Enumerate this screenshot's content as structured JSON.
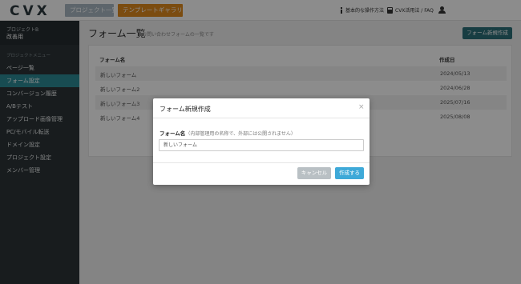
{
  "header": {
    "logo": "CVX",
    "projects_btn": "プロジェクト一覧",
    "templates_btn": "テンプレートギャラリー",
    "ops_link": "基本的な操作方法",
    "faq_link": "CVX活用法 / FAQ",
    "icons": [
      "info-icon",
      "book-icon",
      "user-icon"
    ]
  },
  "sidebar": {
    "project_name": "プロジェクトB",
    "project_sub": "改善用",
    "menu_heading": "プロジェクトメニュー",
    "items": [
      {
        "label": "ページ一覧",
        "active": false
      },
      {
        "label": "フォーム設定",
        "active": true
      },
      {
        "label": "コンバージョン履歴",
        "active": false
      },
      {
        "label": "A/Bテスト",
        "active": false
      },
      {
        "label": "アップロード画像管理",
        "active": false
      },
      {
        "label": "PC/モバイル転送",
        "active": false
      },
      {
        "label": "ドメイン設定",
        "active": false
      },
      {
        "label": "プロジェクト設定",
        "active": false
      },
      {
        "label": "メンバー管理",
        "active": false
      }
    ]
  },
  "main": {
    "title": "フォーム一覧",
    "description": "お問い合わせフォームの一覧です",
    "new_button": "フォーム新規作成",
    "table": {
      "columns": [
        "フォーム名",
        "作成日"
      ],
      "rows": [
        {
          "name": "新しいフォーム",
          "date": "2024/05/13"
        },
        {
          "name": "新しいフォーム2",
          "date": "2024/06/28"
        },
        {
          "name": "新しいフォーム3",
          "date": "2025/07/16"
        },
        {
          "name": "新しいフォーム4",
          "date": "2025/08/08"
        }
      ]
    }
  },
  "modal": {
    "title": "フォーム新規作成",
    "close": "×",
    "field_label": "フォーム名",
    "field_note": "（内部管理用の名称で、外部には公開されません）",
    "field_value": "新しいフォーム",
    "cancel": "キャンセル",
    "create": "作成する"
  },
  "colors": {
    "accent": "#2d8a96",
    "header_btn_projects": "#a9b9c4",
    "header_btn_templates": "#e08a1e",
    "sidebar_bg": "#2c3438",
    "primary_button": "#3ea9d8",
    "cancel_button": "#b9c0c4"
  }
}
